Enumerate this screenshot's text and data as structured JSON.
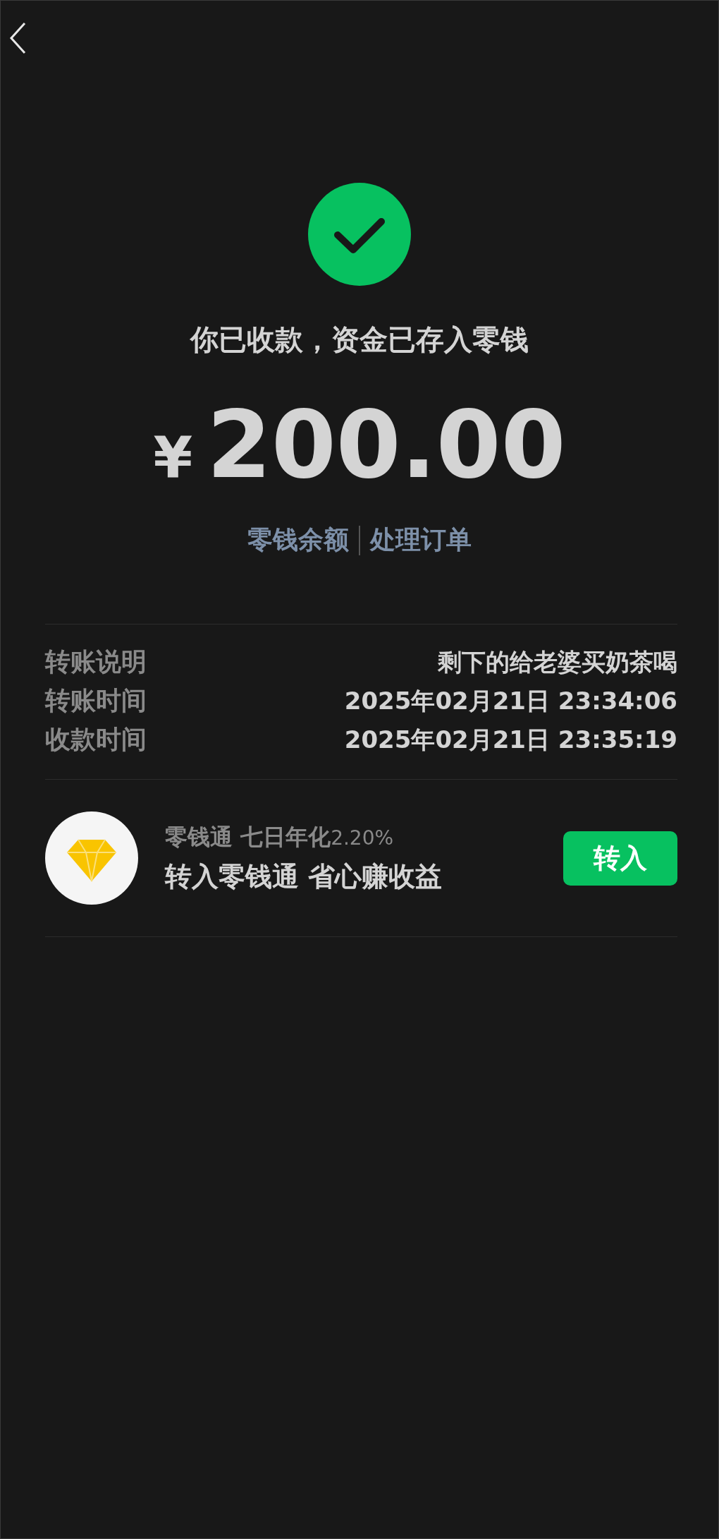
{
  "title": "你已收款，资金已存入零钱",
  "amount": {
    "currency": "¥",
    "value": "200.00"
  },
  "links": [
    "零钱余额",
    "处理订单"
  ],
  "details": [
    {
      "label": "转账说明",
      "value": "剩下的给老婆买奶茶喝"
    },
    {
      "label": "转账时间",
      "value": "2025年02月21日 23:34:06"
    },
    {
      "label": "收款时间",
      "value": "2025年02月21日 23:35:19"
    }
  ],
  "promo": {
    "name": "零钱通 七日年化",
    "rate": "2.20%",
    "headline": "转入零钱通 省心赚收益",
    "button": "转入"
  }
}
